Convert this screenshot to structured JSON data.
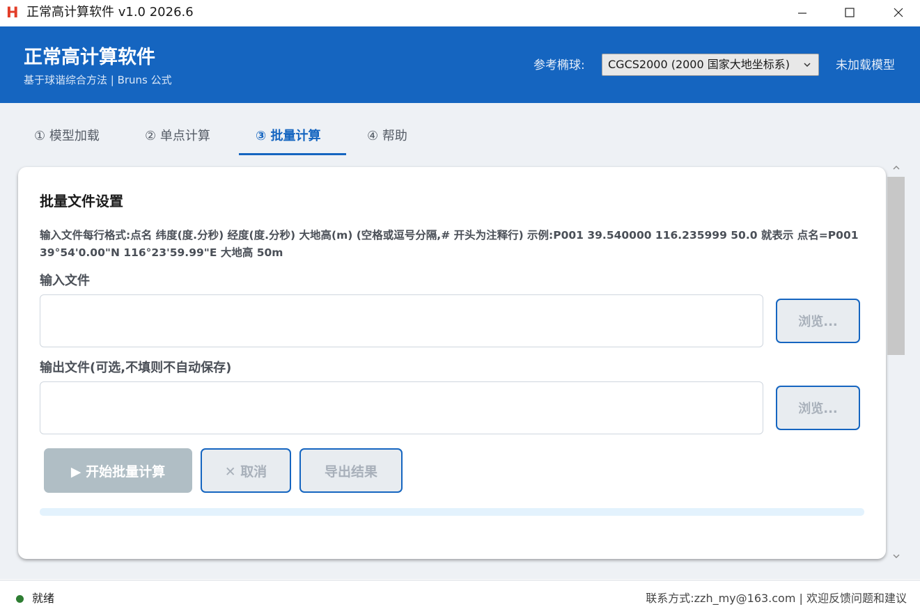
{
  "window": {
    "title": "正常高计算软件 v1.0 2026.6",
    "logo": "H",
    "controls": [
      "minimize-icon",
      "maximize-icon",
      "close-icon"
    ]
  },
  "header": {
    "app_name": "正常高计算软件",
    "subtitle": "基于球谐综合方法 | Bruns 公式",
    "ellipsoid_label": "参考椭球:",
    "ellipsoid_value": "CGCS2000 (2000 国家大地坐标系)",
    "model_status": "未加载模型",
    "colors": {
      "banner": "#1565c0",
      "accent": "#1565c0"
    }
  },
  "tabs": [
    {
      "label": "① 模型加载",
      "active": false
    },
    {
      "label": "② 单点计算",
      "active": false
    },
    {
      "label": "③ 批量计算",
      "active": true
    },
    {
      "label": "④ 帮助",
      "active": false
    }
  ],
  "batch": {
    "title": "批量文件设置",
    "format_hint": "输入文件每行格式:点名 纬度(度.分秒) 经度(度.分秒) 大地高(m) (空格或逗号分隔,# 开头为注释行) 示例:P001 39.540000 116.235999 50.0 就表示 点名=P001 39°54'0.00\"N 116°23'59.99\"E 大地高 50m",
    "input_label": "输入文件",
    "input_value": "",
    "output_label": "输出文件(可选,不填则不自动保存)",
    "output_value": "",
    "browse_label": "浏览...",
    "start_label": "▶ 开始批量计算",
    "cancel_label": "✕ 取消",
    "export_label": "导出结果",
    "progress": 0
  },
  "status": {
    "text": "就绪",
    "contact": "联系方式:zzh_my@163.com | 欢迎反馈问题和建议",
    "dot_color": "#2e7d32"
  }
}
